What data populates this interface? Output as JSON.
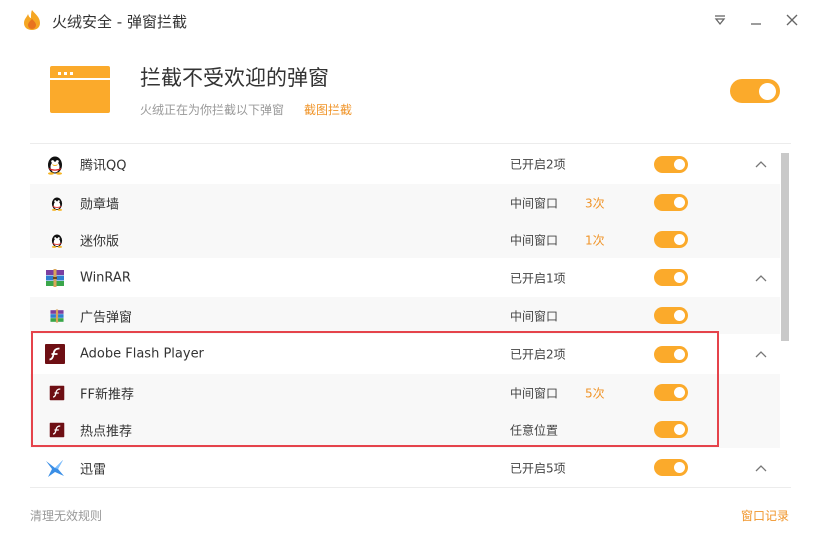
{
  "window": {
    "title": "火绒安全 - 弹窗拦截",
    "icons": {
      "logo": "flame-logo",
      "menu": "menu-down-icon",
      "minimize": "minimize-icon",
      "close": "close-icon"
    }
  },
  "header": {
    "title": "拦截不受欢迎的弹窗",
    "description": "火绒正在为你拦截以下弹窗",
    "link": "截图拦截",
    "master_toggle_on": true
  },
  "colors": {
    "accent": "#fbaa2b",
    "link": "#f0952a",
    "highlight": "#e5434b"
  },
  "groups": [
    {
      "name": "腾讯QQ",
      "status": "已开启2项",
      "icon": "qq-penguin-icon",
      "expanded": true,
      "enabled": true,
      "children": [
        {
          "name": "勋章墙",
          "position": "中间窗口",
          "count": "3次",
          "enabled": true,
          "icon": "qq-penguin-icon"
        },
        {
          "name": "迷你版",
          "position": "中间窗口",
          "count": "1次",
          "enabled": true,
          "icon": "qq-penguin-icon"
        }
      ]
    },
    {
      "name": "WinRAR",
      "status": "已开启1项",
      "icon": "winrar-books-icon",
      "expanded": true,
      "enabled": true,
      "children": [
        {
          "name": "广告弹窗",
          "position": "中间窗口",
          "count": "",
          "enabled": true,
          "icon": "winrar-books-icon"
        }
      ]
    },
    {
      "name": "Adobe Flash Player",
      "status": "已开启2项",
      "icon": "flash-player-icon",
      "expanded": true,
      "enabled": true,
      "children": [
        {
          "name": "FF新推荐",
          "position": "中间窗口",
          "count": "5次",
          "enabled": true,
          "icon": "flash-player-icon"
        },
        {
          "name": "热点推荐",
          "position": "任意位置",
          "count": "",
          "enabled": true,
          "icon": "flash-player-icon"
        }
      ]
    },
    {
      "name": "迅雷",
      "status": "已开启5项",
      "icon": "thunder-bird-icon",
      "expanded": true,
      "enabled": true,
      "children": []
    }
  ],
  "footer": {
    "left_link": "清理无效规则",
    "right_link": "窗口记录"
  }
}
